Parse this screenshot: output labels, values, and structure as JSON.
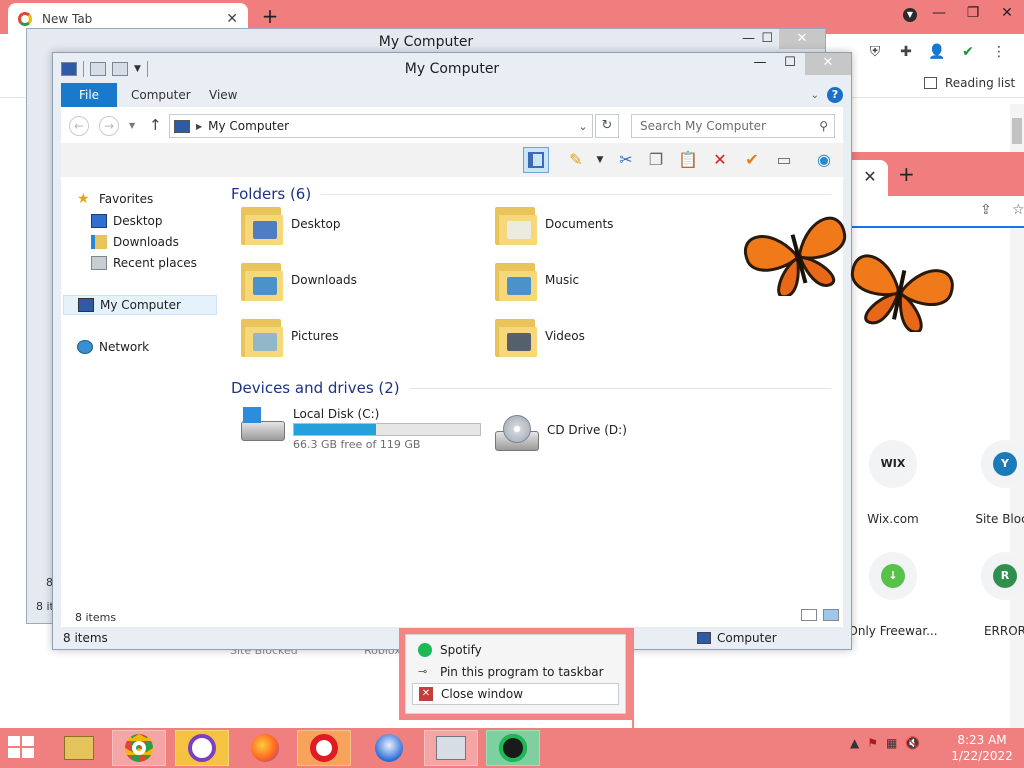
{
  "chrome": {
    "tab_title": "New Tab",
    "reading_list": "Reading list",
    "tab_close": "✕",
    "new_tab": "+"
  },
  "background_window": {
    "title": "My Computer"
  },
  "window": {
    "title": "My Computer",
    "ribbon_tabs": [
      "File",
      "Computer",
      "View"
    ],
    "address": "My Computer",
    "search_placeholder": "Search My Computer",
    "favorites": {
      "header": "Favorites",
      "items": [
        "Desktop",
        "Downloads",
        "Recent places"
      ]
    },
    "nav": {
      "computer": "My Computer",
      "network": "Network"
    },
    "folders_header": "Folders (6)",
    "folders": [
      {
        "name": "Desktop",
        "emblem": "desktop-icon",
        "color": "#2f6fcf"
      },
      {
        "name": "Documents",
        "emblem": "documents-icon",
        "color": "#e9eef5"
      },
      {
        "name": "Downloads",
        "emblem": "download-arrow-icon",
        "color": "#2c86d8"
      },
      {
        "name": "Music",
        "emblem": "music-note-icon",
        "color": "#2c86d8"
      },
      {
        "name": "Pictures",
        "emblem": "pictures-icon",
        "color": "#7fb2d9"
      },
      {
        "name": "Videos",
        "emblem": "film-strip-icon",
        "color": "#3a4a6a"
      }
    ],
    "drives_header": "Devices and drives (2)",
    "drives": [
      {
        "name": "Local Disk (C:)",
        "free": "66.3 GB free of 119 GB",
        "used_fraction": 0.44
      },
      {
        "name": "CD Drive (D:)"
      }
    ],
    "status_items": "8 items",
    "status_computer": "Computer"
  },
  "background_labels": {
    "left_count": "8 it",
    "left_digit": "8",
    "site_blocked": "Site Blocked",
    "roblox": "Roblox"
  },
  "shortcuts": [
    {
      "label": "Wix.com",
      "initial": "WIX",
      "color": "#f1f3f4",
      "text": "#222222"
    },
    {
      "label": "Site Block",
      "initial": "Y",
      "color": "#1c7ab8",
      "text": "#ffffff"
    },
    {
      "label": "Only Freewar...",
      "initial": "↓",
      "color": "#57c14a",
      "text": "#ffffff"
    },
    {
      "label": "ERROR",
      "initial": "R",
      "color": "#2f8f4e",
      "text": "#ffffff"
    }
  ],
  "jumplist": {
    "app": "Spotify",
    "pin": "Pin this program to taskbar",
    "close": "Close window"
  },
  "taskbar": {
    "time": "8:23 AM",
    "date": "1/22/2022"
  },
  "colors": {
    "chrome_tabbar": "#f07e7e",
    "taskbar": "#f08080",
    "file_tab": "#1979ca",
    "progress": "#26a0da",
    "group_header": "#1e3287"
  }
}
